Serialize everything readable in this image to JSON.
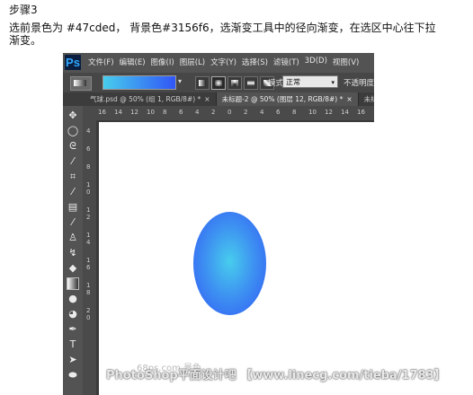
{
  "step_title": "步骤3",
  "instruction": "选前景色为 #47cded， 背景色#3156f6，选渐变工具中的径向渐变，在选区中心往下拉渐变。",
  "app": {
    "logo": "Ps",
    "menu": [
      "文件(F)",
      "编辑(E)",
      "图像(I)",
      "图层(L)",
      "文字(Y)",
      "选择(S)",
      "滤镜(T)",
      "3D(D)",
      "视图(V)"
    ]
  },
  "options_bar": {
    "gradient_colors": [
      "#47cded",
      "#3156f6"
    ],
    "gradient_types": [
      "linear",
      "radial",
      "angle",
      "reflected",
      "diamond"
    ],
    "active_gradient_type": "radial",
    "mode_label": "模式:",
    "mode_value": "正常",
    "opacity_label": "不透明度:"
  },
  "tabs": [
    {
      "label": "气球.psd @ 50% (组 1, RGB/8#) *",
      "close": "×",
      "active": false
    },
    {
      "label": "未标题-2 @ 50% (图层 12, RGB/8#) *",
      "close": "×",
      "active": true
    },
    {
      "label": "未标",
      "close": "",
      "active": false
    }
  ],
  "rulers": {
    "top": [
      "16",
      "14",
      "12",
      "10",
      "8",
      "6",
      "4",
      "2",
      "0",
      "2",
      "4",
      "6",
      "8",
      "10",
      "12",
      "14",
      "16"
    ],
    "left": [
      "4",
      "6",
      "8",
      "1",
      "0",
      "1",
      "2",
      "1",
      "4",
      "1",
      "6",
      "1",
      "8",
      "2",
      "0"
    ]
  },
  "tools": [
    "move-icon",
    "marquee-icon",
    "lasso-icon",
    "magic-wand-icon",
    "crop-icon",
    "eyedropper-icon",
    "healing-brush-icon",
    "brush-icon",
    "clone-stamp-icon",
    "history-brush-icon",
    "eraser-icon",
    "gradient-icon",
    "blur-icon",
    "dodge-icon",
    "pen-icon",
    "type-icon",
    "path-selection-icon",
    "shape-icon"
  ],
  "watermark": "PhotoShop平面设计吧 【www.linecg.com/tieba/1783】",
  "watermark_small": "68ps.com 景色"
}
